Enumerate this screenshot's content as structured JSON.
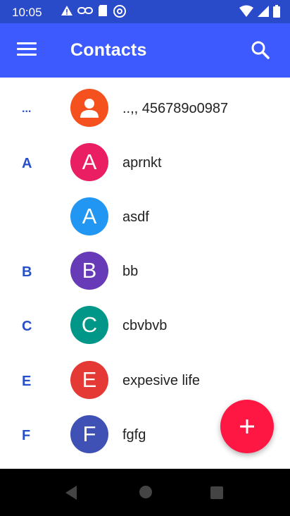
{
  "status_bar": {
    "time": "10:05",
    "left_icons": [
      "warning-icon",
      "link-icon",
      "sd-card-icon",
      "at-icon"
    ],
    "right_icons": [
      "wifi-icon",
      "signal-icon",
      "battery-icon"
    ]
  },
  "app_bar": {
    "title": "Contacts",
    "menu_icon": "hamburger-menu-icon",
    "search_icon": "search-icon"
  },
  "contacts": [
    {
      "section": "...",
      "initial": "",
      "name": "..,, 456789o0987",
      "color": "#f4511e"
    },
    {
      "section": "A",
      "initial": "A",
      "name": "aprnkt",
      "color": "#e91e63"
    },
    {
      "section": "",
      "initial": "A",
      "name": "asdf",
      "color": "#2196f3"
    },
    {
      "section": "B",
      "initial": "B",
      "name": "bb",
      "color": "#673ab7"
    },
    {
      "section": "C",
      "initial": "C",
      "name": "cbvbvb",
      "color": "#009688"
    },
    {
      "section": "E",
      "initial": "E",
      "name": "expesive life",
      "color": "#e53935"
    },
    {
      "section": "F",
      "initial": "F",
      "name": "fgfg",
      "color": "#3f51b5"
    }
  ],
  "fab": {
    "icon": "plus-icon",
    "color": "#ff1744"
  },
  "nav_bar": {
    "icons": [
      "back-icon",
      "home-icon",
      "recents-icon"
    ]
  }
}
